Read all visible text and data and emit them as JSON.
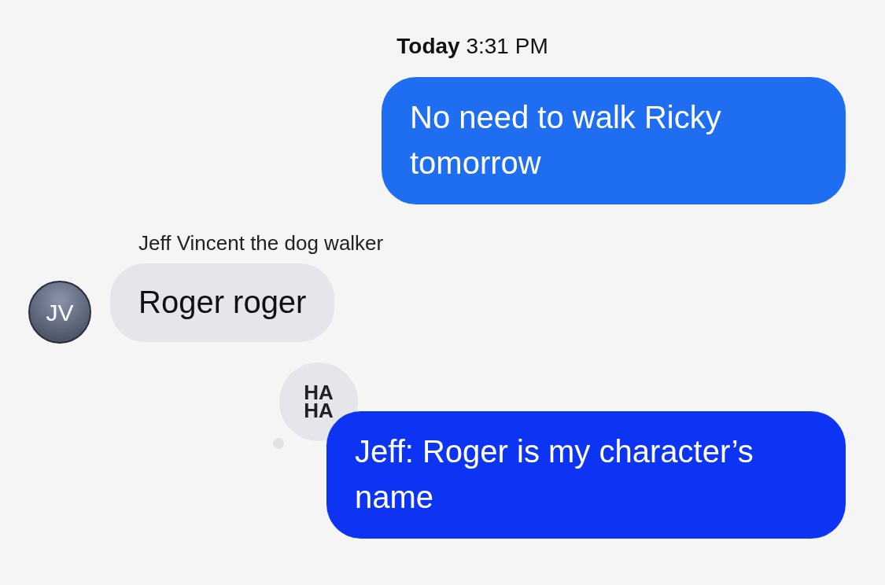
{
  "timestamp": {
    "day": "Today",
    "time": "3:31 PM"
  },
  "messages": [
    {
      "kind": "sent",
      "color": "#1f6ef2",
      "text": "No need to walk Ricky tomorrow"
    },
    {
      "kind": "received",
      "sender": "Jeff Vincent the dog walker",
      "avatar": "JV",
      "text": "Roger roger"
    },
    {
      "kind": "sent",
      "color": "#0c34f2",
      "reaction": [
        "HA",
        "HA"
      ],
      "text": "Jeff: Roger is my character’s name"
    }
  ]
}
